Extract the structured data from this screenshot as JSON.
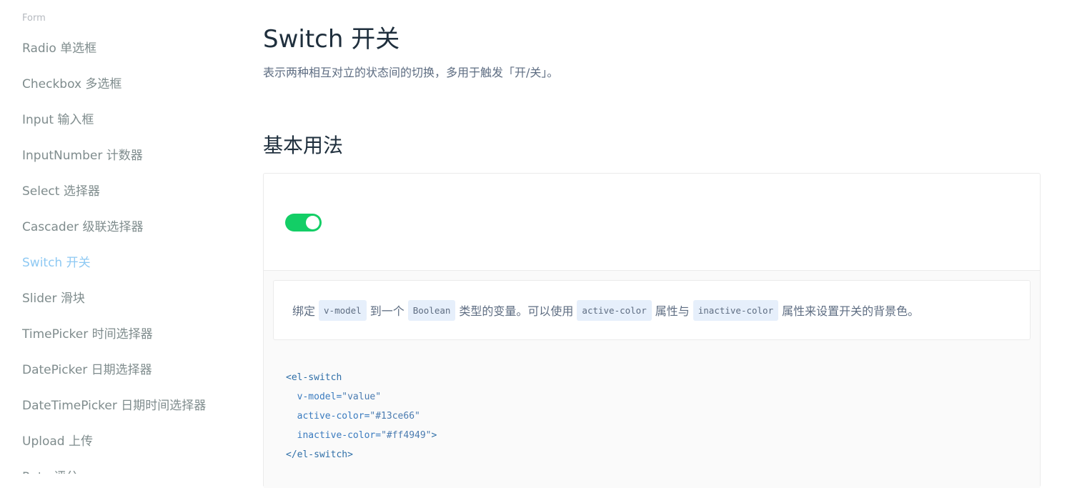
{
  "sidebar": {
    "group_label": "Form",
    "items": [
      {
        "label": "Radio 单选框"
      },
      {
        "label": "Checkbox 多选框"
      },
      {
        "label": "Input 输入框"
      },
      {
        "label": "InputNumber 计数器"
      },
      {
        "label": "Select 选择器"
      },
      {
        "label": "Cascader 级联选择器"
      },
      {
        "label": "Switch 开关"
      },
      {
        "label": "Slider 滑块"
      },
      {
        "label": "TimePicker 时间选择器"
      },
      {
        "label": "DatePicker 日期选择器"
      },
      {
        "label": "DateTimePicker 日期时间选择器"
      },
      {
        "label": "Upload 上传"
      },
      {
        "label": "Rate 评分"
      }
    ],
    "active_item": "Switch 开关"
  },
  "page": {
    "title": "Switch 开关",
    "description": "表示两种相互对立的状态间的切换，多用于触发「开/关」。"
  },
  "section": {
    "title": "基本用法"
  },
  "demo": {
    "switch": {
      "state": "on",
      "active_color": "#13ce66",
      "inactive_color": "#ff4949"
    },
    "description": {
      "t1": "绑定",
      "c1": "v-model",
      "t2": "到一个",
      "c2": "Boolean",
      "t3": "类型的变量。可以使用",
      "c3": "active-color",
      "t4": "属性与",
      "c4": "inactive-color",
      "t5": "属性来设置开关的背景色。"
    },
    "code": {
      "l1_tag": "<el-switch",
      "l2_attr": "v-model=",
      "l2_val": "\"value\"",
      "l3_attr": "active-color=",
      "l3_val": "\"#13ce66\"",
      "l4_attr": "inactive-color=",
      "l4_val": "\"#ff4949\"",
      "l4_end": ">",
      "l5_tag": "</el-switch>"
    }
  },
  "colors": {
    "sidebar_active": "#8ec9f3",
    "sidebar_text": "#7f8c8d",
    "switch_on": "#13ce66"
  }
}
